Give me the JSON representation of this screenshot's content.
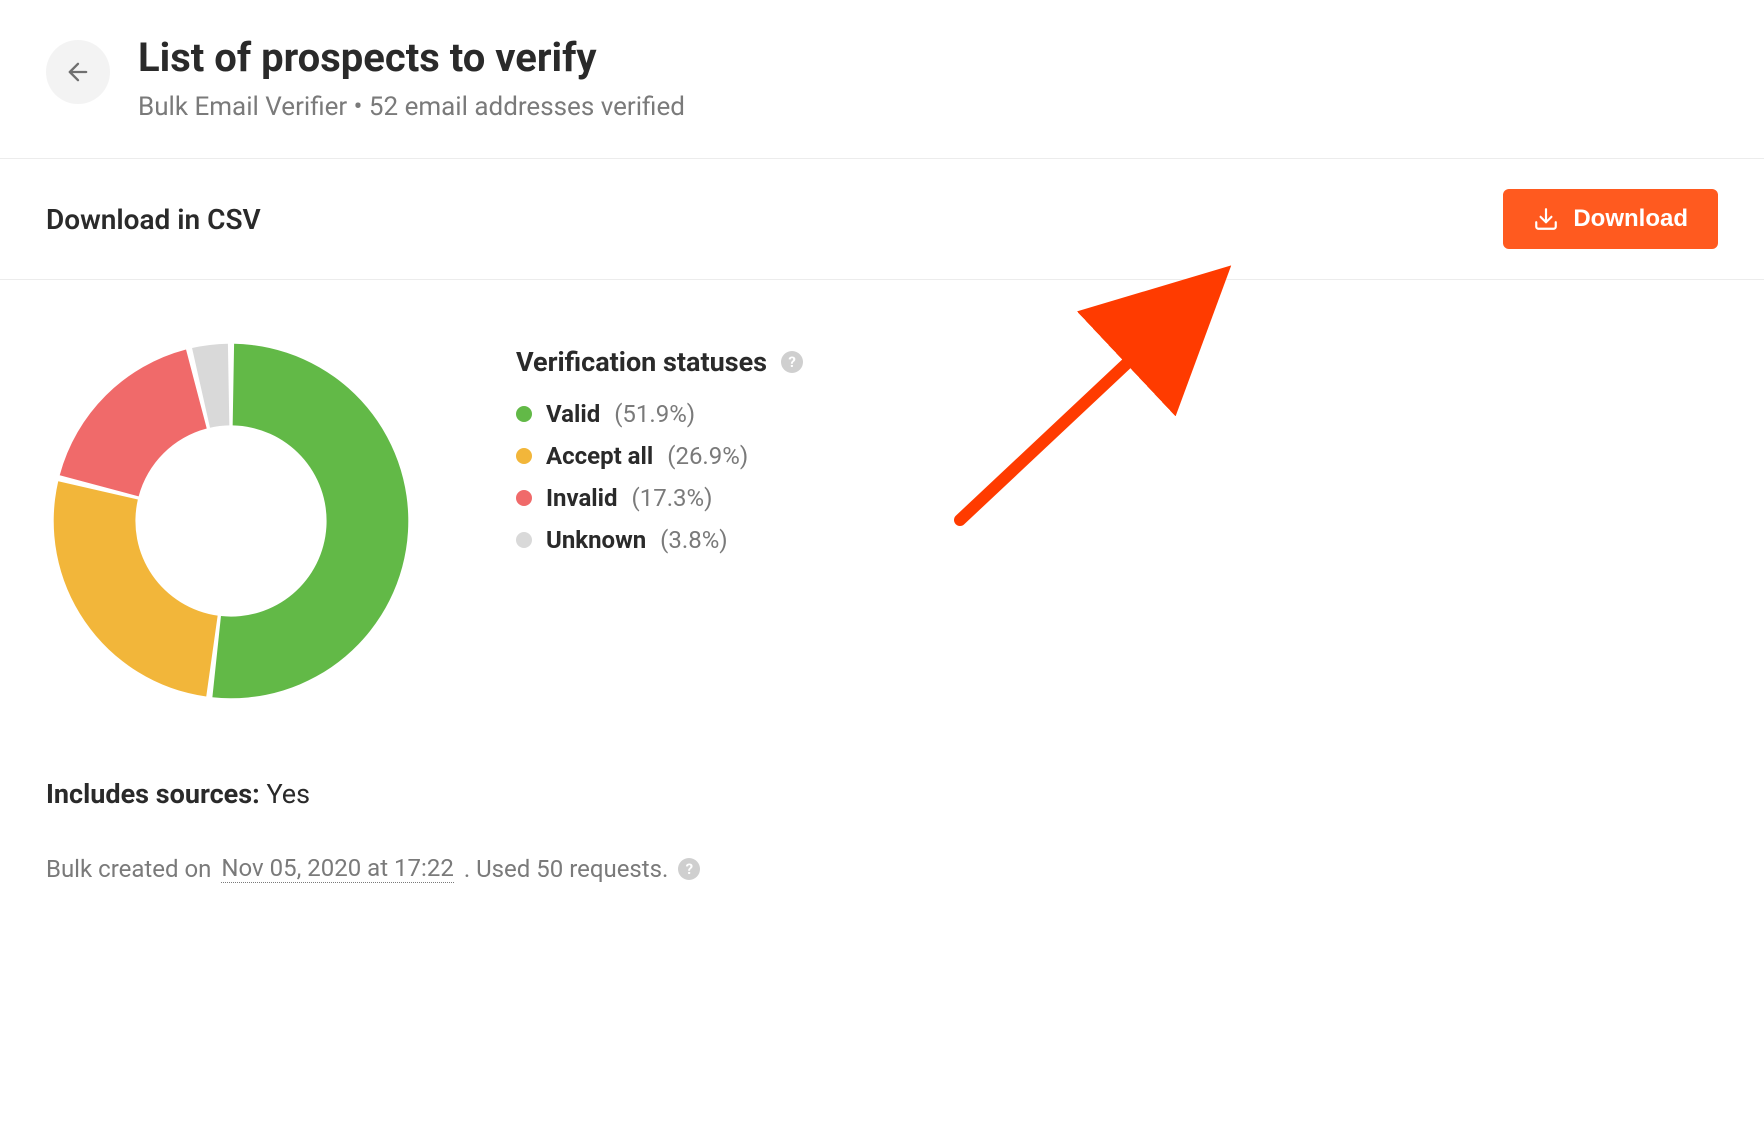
{
  "header": {
    "title": "List of prospects to verify",
    "subtitle": "Bulk Email Verifier • 52 email addresses verified"
  },
  "download": {
    "section_label": "Download in CSV",
    "button_label": "Download"
  },
  "legend": {
    "title": "Verification statuses",
    "items": [
      {
        "label": "Valid",
        "value": "(51.9%)",
        "color": "#62b947"
      },
      {
        "label": "Accept all",
        "value": "(26.9%)",
        "color": "#f2b63a"
      },
      {
        "label": "Invalid",
        "value": "(17.3%)",
        "color": "#f06a6a"
      },
      {
        "label": "Unknown",
        "value": "(3.8%)",
        "color": "#d9d9d9"
      }
    ]
  },
  "sources": {
    "label": "Includes sources:",
    "value": "Yes"
  },
  "footer": {
    "prefix": "Bulk created on",
    "date": "Nov 05, 2020 at 17:22",
    "suffix": ". Used 50 requests."
  },
  "chart_data": {
    "type": "pie",
    "title": "Verification statuses",
    "categories": [
      "Valid",
      "Accept all",
      "Invalid",
      "Unknown"
    ],
    "values": [
      51.9,
      26.9,
      17.3,
      3.8
    ],
    "colors": [
      "#62b947",
      "#f2b63a",
      "#f06a6a",
      "#d9d9d9"
    ]
  }
}
